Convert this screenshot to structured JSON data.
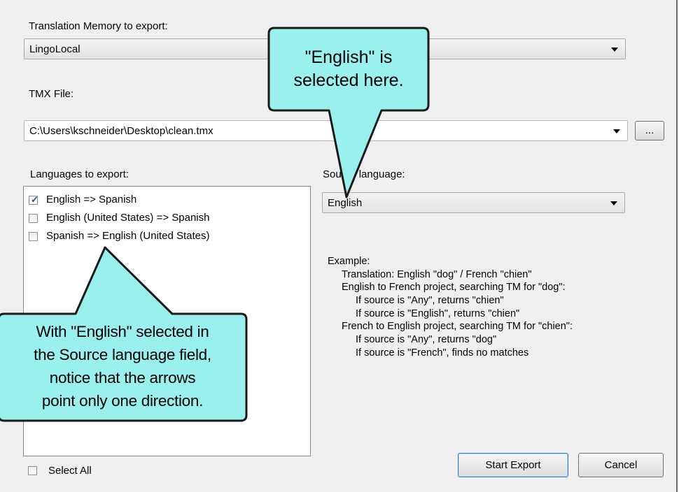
{
  "dialog": {
    "tm_label": "Translation Memory to export:",
    "tm_value": "LingoLocal",
    "tmx_label": "TMX File:",
    "tmx_path": "C:\\Users\\kschneider\\Desktop\\clean.tmx",
    "browse_label": "...",
    "languages_label": "Languages to export:",
    "source_label": "Source language:",
    "source_value": "English",
    "languages": [
      {
        "label": "English => Spanish",
        "checked": true
      },
      {
        "label": "English (United States) => Spanish",
        "checked": false
      },
      {
        "label": "Spanish => English (United States)",
        "checked": false
      }
    ],
    "example_lines": [
      "Example:",
      "Translation: English \"dog\" / French \"chien\"",
      "English to French project, searching TM for \"dog\":",
      "If source is \"Any\", returns \"chien\"",
      "If source is \"English\", returns \"chien\"",
      "French to English project, searching TM for \"chien\":",
      "If source is \"Any\", returns \"dog\"",
      "If source is \"French\", finds no matches"
    ],
    "select_all_label": "Select All",
    "start_export_label": "Start Export",
    "cancel_label": "Cancel"
  },
  "callouts": {
    "top_lines": [
      "\"English\" is",
      "selected here."
    ],
    "bottom_lines": [
      "With \"English\" selected in",
      "the Source language field,",
      "notice that the arrows",
      "point only one direction."
    ]
  },
  "colors": {
    "callout_fill": "#99f0ec",
    "callout_border": "#1a1a1a",
    "dialog_bg": "#f0f0f0"
  }
}
